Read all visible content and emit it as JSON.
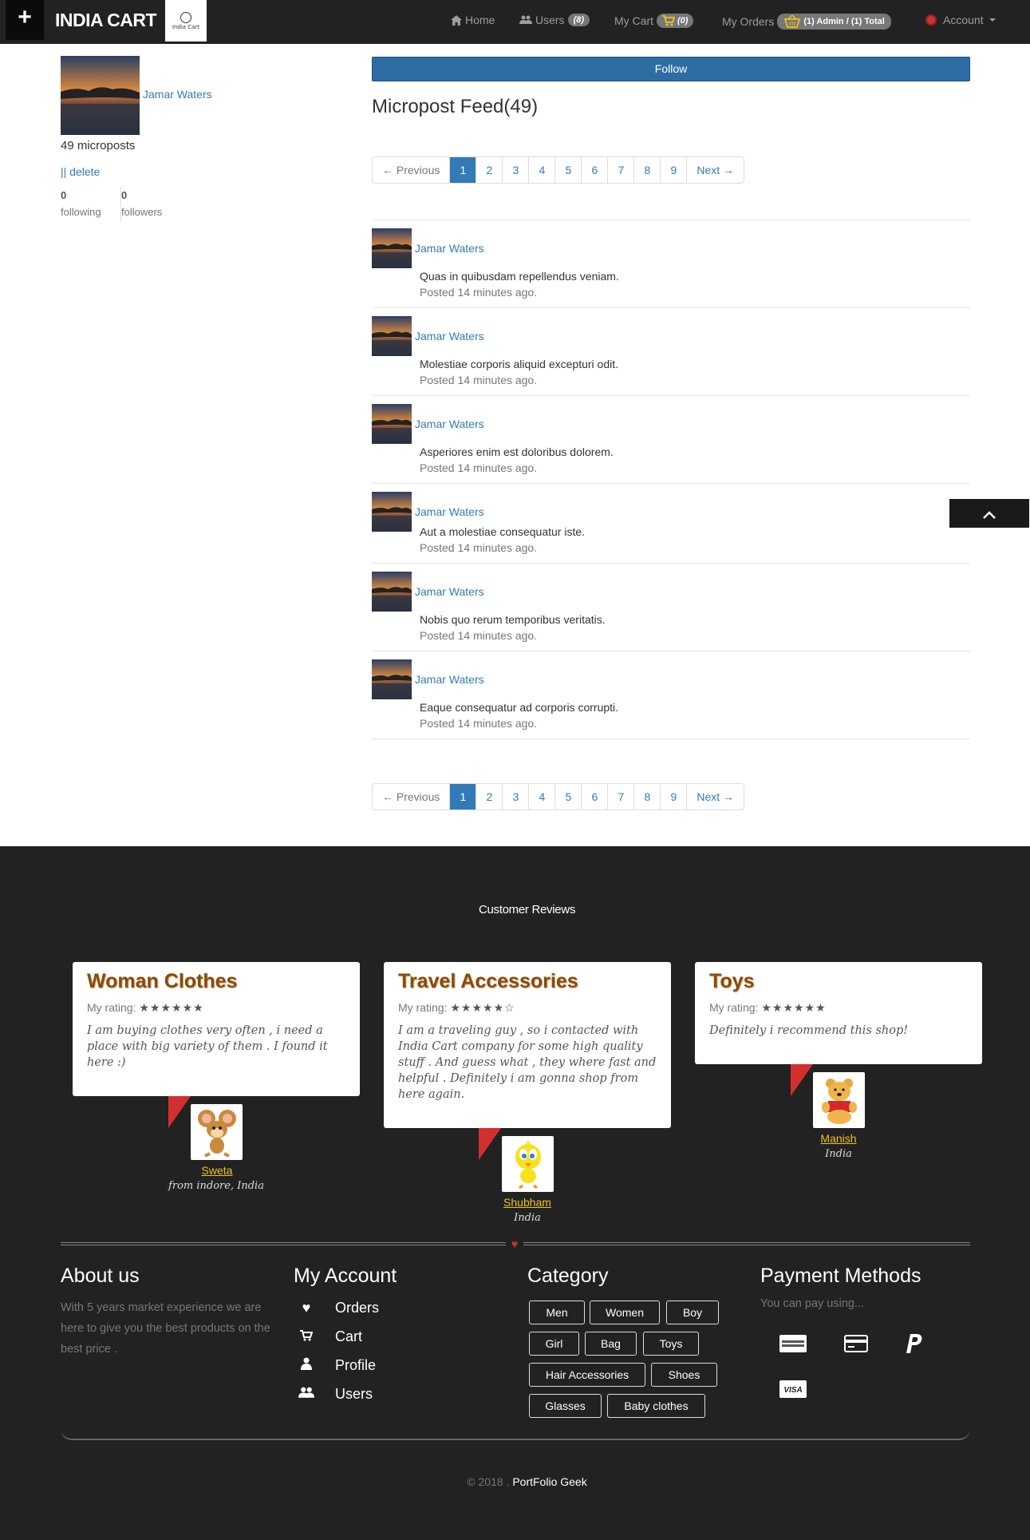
{
  "nav": {
    "brand": "INDIA CART",
    "logo_text": "India Cart",
    "home": "Home",
    "users": "Users",
    "users_count": "(8)",
    "my_cart": "My Cart",
    "cart_count": "(0)",
    "my_orders": "My Orders",
    "orders_badge": "(1) Admin / (1) Total",
    "account": "Account"
  },
  "profile": {
    "name": "Jamar Waters",
    "microposts": "49 microposts",
    "delete": "|| delete",
    "following_count": "0",
    "following_label": "following",
    "followers_count": "0",
    "followers_label": "followers"
  },
  "follow_button": "Follow",
  "feed_title": "Micropost Feed(49)",
  "pager": {
    "previous": "← Previous",
    "next": "Next →",
    "pages": [
      "1",
      "2",
      "3",
      "4",
      "5",
      "6",
      "7",
      "8",
      "9"
    ],
    "active": "1"
  },
  "posts": [
    {
      "name": "Jamar Waters",
      "content": "Quas in quibusdam repellendus veniam.",
      "time": "Posted 14 minutes ago."
    },
    {
      "name": "Jamar Waters",
      "content": "Molestiae corporis aliquid excepturi odit.",
      "time": "Posted 14 minutes ago."
    },
    {
      "name": "Jamar Waters",
      "content": "Asperiores enim est doloribus dolorem.",
      "time": "Posted 14 minutes ago."
    },
    {
      "name": "Jamar Waters",
      "content": "Aut a molestiae consequatur iste.",
      "time": "Posted 14 minutes ago."
    },
    {
      "name": "Jamar Waters",
      "content": "Nobis quo rerum temporibus veritatis.",
      "time": "Posted 14 minutes ago."
    },
    {
      "name": "Jamar Waters",
      "content": "Eaque consequatur ad corporis corrupti.",
      "time": "Posted 14 minutes ago."
    }
  ],
  "reviews_title": "Customer Reviews",
  "reviews": [
    {
      "title": "Woman Clothes",
      "rating_label": "My rating:",
      "stars": "★★★★★★",
      "text": "I am buying clothes very often , i need a place with big variety of them . I found it here :)",
      "name": "Sweta",
      "location": "from indore, India",
      "avatar": "mouse-cartoon-icon"
    },
    {
      "title": "Travel Accessories",
      "rating_label": "My rating:",
      "stars": "★★★★★☆",
      "text": "I am a traveling guy , so i contacted with India Cart company for some high quality stuff . And guess what , they where fast and helpful . Definitely i am gonna shop from here again.",
      "name": "Shubham",
      "location": "India",
      "avatar": "bird-cartoon-icon"
    },
    {
      "title": "Toys",
      "rating_label": "My rating:",
      "stars": "★★★★★★",
      "text": "Definitely i recommend this shop!",
      "name": "Manish",
      "location": "India",
      "avatar": "bear-cartoon-icon"
    }
  ],
  "footer": {
    "about_title": "About us",
    "about_text": "With 5 years market experience we are here to give you the best products on the best price .",
    "account_title": "My Account",
    "account_items": [
      "Orders",
      "Cart",
      "Profile",
      "Users"
    ],
    "category_title": "Category",
    "categories": [
      "Men",
      "Women",
      "Boy",
      "Girl",
      "Bag",
      "Toys",
      "Hair Accessories",
      "Shoes",
      "Glasses",
      "Baby clothes"
    ],
    "payment_title": "Payment Methods",
    "payment_text": "You can pay using...",
    "payment_methods": [
      "amex-icon",
      "credit-card-icon",
      "paypal-icon",
      "visa-icon"
    ],
    "copyright_prefix": "© 2018 .",
    "copyright_name": "PortFolio Geek"
  },
  "colors": {
    "nav_bg": "#222222",
    "primary": "#337ab7",
    "footer_bg": "#222222",
    "review_title": "#8a4b08",
    "reviewer_name": "#f0c419",
    "flag": "#d32f2f"
  }
}
